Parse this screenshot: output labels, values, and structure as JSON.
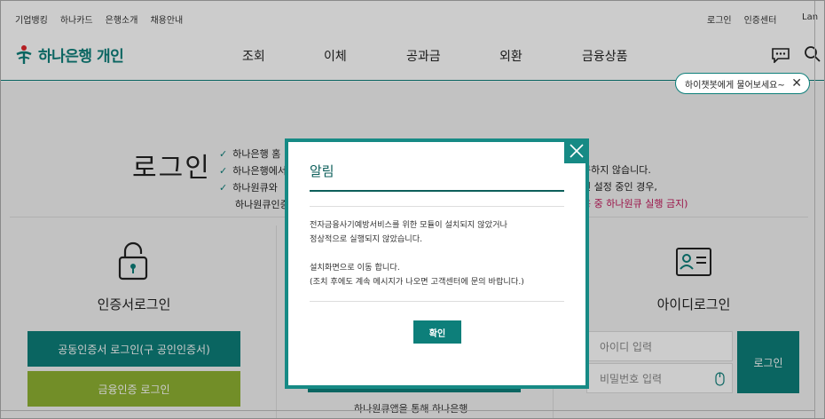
{
  "util": {
    "left_links": [
      "기업뱅킹",
      "하나카드",
      "은행소개",
      "채용안내"
    ],
    "right_links": [
      "로그인",
      "인증센터"
    ],
    "lang": "Lan"
  },
  "header": {
    "logo_text": "하나은행 개인",
    "nav": [
      "조회",
      "이체",
      "공과금",
      "외환",
      "금융상품"
    ],
    "chat_bubble": "하이챗봇에게 물어보세요~"
  },
  "page": {
    "title": "로그인",
    "notices": [
      "하나은행 홈",
      "하나은행에서",
      "하나원큐와",
      "하나원큐인증"
    ],
    "notice_right": [
      "구하지 않습니다.",
      "인 설정 중인 경우,",
      "용 중 하나원큐 실행 금지)"
    ],
    "cert_login": {
      "title": "인증서로그인",
      "btn_cert": "공동인증서 로그인(구 공인인증서)",
      "btn_fin": "금융인증 로그인"
    },
    "mid_text": "하나원큐앱을 통해 하나은행",
    "id_login": {
      "title": "아이디로그인",
      "id_placeholder": "아이디 입력",
      "pw_placeholder": "비밀번호 입력",
      "btn_login": "로그인"
    }
  },
  "modal": {
    "title": "알림",
    "message": "전자금융사기예방서비스를 위한 모듈이 설치되지 않았거나\n정상적으로 실행되지 않았습니다.\n\n설치화면으로 이동 합니다.\n(조치 후에도 계속 메시지가 나오면 고객센터에 문의 바랍니다.)",
    "ok_label": "확인"
  },
  "colors": {
    "brand": "#0d7f7a",
    "modal_border": "#168a85",
    "green_button": "#8fb232",
    "warning_text": "#c2185b"
  }
}
